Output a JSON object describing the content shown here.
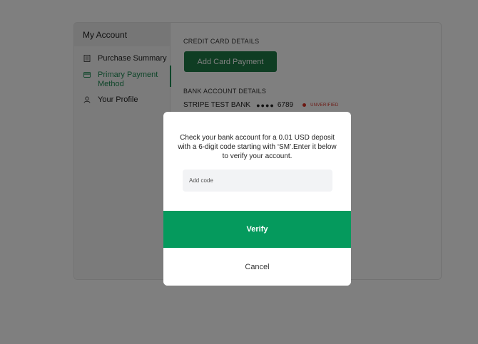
{
  "sidebar": {
    "title": "My Account",
    "items": [
      {
        "label": "Purchase Summary",
        "icon": "receipt-icon"
      },
      {
        "label": "Primary Payment Method",
        "icon": "credit-card-icon",
        "active": true
      },
      {
        "label": "Your Profile",
        "icon": "user-icon"
      }
    ]
  },
  "content": {
    "credit_card_heading": "CREDIT CARD DETAILS",
    "add_card_label": "Add Card Payment",
    "bank_heading": "BANK ACCOUNT DETAILS",
    "bank_name": "STRIPE TEST BANK",
    "bank_mask": "●●●●",
    "bank_last4": "6789",
    "bank_status": "UNVERIFIED"
  },
  "modal": {
    "message": "Check your bank account for a 0.01 USD deposit with a 6-digit code starting with ‘SM’.Enter it below to verify your account.",
    "code_placeholder": "Add code",
    "code_value": "",
    "verify_label": "Verify",
    "cancel_label": "Cancel"
  },
  "colors": {
    "accent_green": "#059a5d",
    "button_green": "#1e7b46",
    "status_red": "#d93025",
    "overlay": "rgba(0,0,0,0.5)"
  }
}
